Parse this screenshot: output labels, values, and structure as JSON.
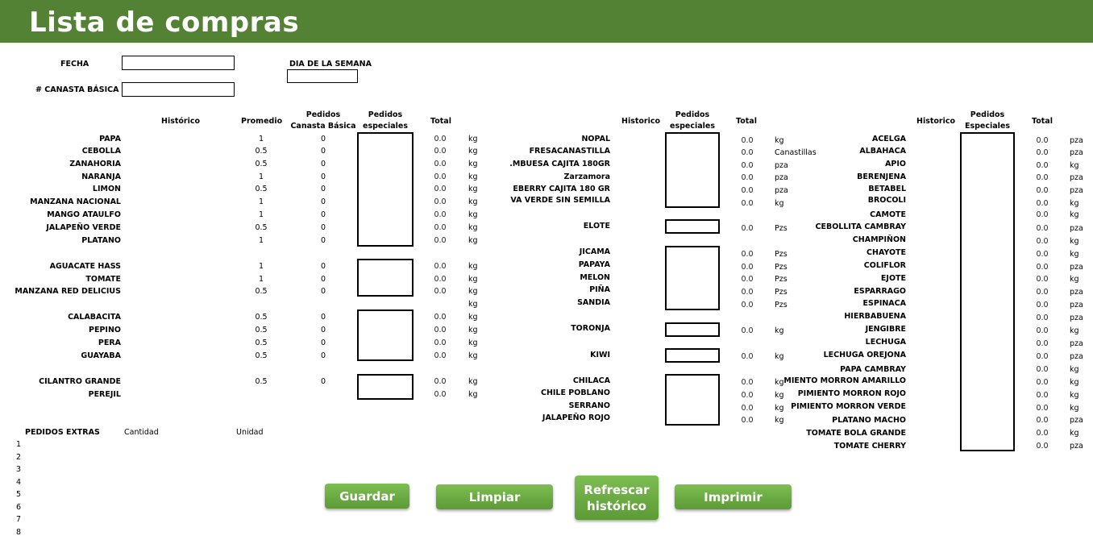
{
  "header": {
    "title": "Lista de compras"
  },
  "form": {
    "fecha_label": "FECHA",
    "dia_label": "DIA DE LA SEMANA",
    "canasta_label": "# CANASTA BÁSICA"
  },
  "col1": {
    "headers": {
      "historico": "Histórico",
      "promedio": "Promedio",
      "pedidos_canasta": "Pedidos Canasta Básica",
      "pedidos_especiales": "Pedidos especiales",
      "total": "Total"
    },
    "rows": [
      {
        "name": "PAPA",
        "promedio": "1",
        "canasta": "0",
        "total": "0.0",
        "unit": "kg"
      },
      {
        "name": "CEBOLLA",
        "promedio": "0.5",
        "canasta": "0",
        "total": "0.0",
        "unit": "kg"
      },
      {
        "name": "ZANAHORIA",
        "promedio": "0.5",
        "canasta": "0",
        "total": "0.0",
        "unit": "kg"
      },
      {
        "name": "NARANJA",
        "promedio": "1",
        "canasta": "0",
        "total": "0.0",
        "unit": "kg"
      },
      {
        "name": "LIMON",
        "promedio": "0.5",
        "canasta": "0",
        "total": "0.0",
        "unit": "kg"
      },
      {
        "name": "MANZANA NACIONAL",
        "promedio": "1",
        "canasta": "0",
        "total": "0.0",
        "unit": "kg"
      },
      {
        "name": "MANGO ATAULFO",
        "promedio": "1",
        "canasta": "0",
        "total": "0.0",
        "unit": "kg"
      },
      {
        "name": "JALAPEÑO VERDE",
        "promedio": "0.5",
        "canasta": "0",
        "total": "0.0",
        "unit": "kg"
      },
      {
        "name": "PLATANO",
        "promedio": "1",
        "canasta": "0",
        "total": "0.0",
        "unit": "kg"
      },
      {
        "name": "AGUACATE HASS",
        "promedio": "1",
        "canasta": "0",
        "total": "0.0",
        "unit": "kg"
      },
      {
        "name": "TOMATE",
        "promedio": "1",
        "canasta": "0",
        "total": "0.0",
        "unit": "kg"
      },
      {
        "name": "MANZANA RED DELICIUS",
        "promedio": "0.5",
        "canasta": "0",
        "total": "0.0",
        "unit": "kg"
      },
      {
        "name": "",
        "promedio": "",
        "canasta": "",
        "total": "",
        "unit": "kg"
      },
      {
        "name": "CALABACITA",
        "promedio": "0.5",
        "canasta": "0",
        "total": "0.0",
        "unit": "kg"
      },
      {
        "name": "PEPINO",
        "promedio": "0.5",
        "canasta": "0",
        "total": "0.0",
        "unit": "kg"
      },
      {
        "name": "PERA",
        "promedio": "0.5",
        "canasta": "0",
        "total": "0.0",
        "unit": "kg"
      },
      {
        "name": "GUAYABA",
        "promedio": "0.5",
        "canasta": "0",
        "total": "0.0",
        "unit": "kg"
      },
      {
        "name": "CILANTRO GRANDE",
        "promedio": "0.5",
        "canasta": "0",
        "total": "0.0",
        "unit": "kg"
      },
      {
        "name": "PEREJIL",
        "promedio": "",
        "canasta": "",
        "total": "0.0",
        "unit": "kg"
      }
    ]
  },
  "col2": {
    "headers": {
      "historico": "Historico",
      "pedidos_especiales": "Pedidos especiales",
      "total": "Total"
    },
    "rows": [
      {
        "name": "NOPAL",
        "total": "0.0",
        "unit": "kg"
      },
      {
        "name": "FRESACANASTILLA",
        "total": "0.0",
        "unit": "Canastillas"
      },
      {
        "name": ".MBUESA CAJITA 180GR",
        "total": "0.0",
        "unit": "pza"
      },
      {
        "name": "Zarzamora",
        "total": "0.0",
        "unit": "pza"
      },
      {
        "name": "EBERRY CAJITA 180 GR",
        "total": "0.0",
        "unit": "pza"
      },
      {
        "name": "VA VERDE SIN SEMILLA",
        "total": "0.0",
        "unit": "kg"
      },
      {
        "name": "ELOTE",
        "total": "0.0",
        "unit": "Pzs"
      },
      {
        "name": "JICAMA",
        "total": "0.0",
        "unit": "Pzs"
      },
      {
        "name": "PAPAYA",
        "total": "0.0",
        "unit": "Pzs"
      },
      {
        "name": "MELON",
        "total": "0.0",
        "unit": "Pzs"
      },
      {
        "name": "PIÑA",
        "total": "0.0",
        "unit": "Pzs"
      },
      {
        "name": "SANDIA",
        "total": "0.0",
        "unit": "Pzs"
      },
      {
        "name": "TORONJA",
        "total": "0.0",
        "unit": "kg"
      },
      {
        "name": "KIWI",
        "total": "0.0",
        "unit": "kg"
      },
      {
        "name": "CHILACA",
        "total": "0.0",
        "unit": "kg"
      },
      {
        "name": "CHILE POBLANO",
        "total": "0.0",
        "unit": "kg"
      },
      {
        "name": "SERRANO",
        "total": "0.0",
        "unit": "kg"
      },
      {
        "name": "JALAPEÑO ROJO",
        "total": "0.0",
        "unit": "kg"
      }
    ]
  },
  "col3": {
    "headers": {
      "historico": "Historico",
      "pedidos_especiales": "Pedidos Especiales",
      "total": "Total"
    },
    "rows": [
      {
        "name": "ACELGA",
        "total": "0.0",
        "unit": "pza"
      },
      {
        "name": "ALBAHACA",
        "total": "0.0",
        "unit": "pza"
      },
      {
        "name": "APIO",
        "total": "0.0",
        "unit": "kg"
      },
      {
        "name": "BERENJENA",
        "total": "0.0",
        "unit": "pza"
      },
      {
        "name": "BETABEL",
        "total": "0.0",
        "unit": "pza"
      },
      {
        "name": "BROCOLI",
        "total": "0.0",
        "unit": "kg"
      },
      {
        "name": "CAMOTE",
        "total": "0.0",
        "unit": "kg"
      },
      {
        "name": "CEBOLLITA CAMBRAY",
        "total": "0.0",
        "unit": "pza"
      },
      {
        "name": "CHAMPIÑON",
        "total": "0.0",
        "unit": "kg"
      },
      {
        "name": "CHAYOTE",
        "total": "0.0",
        "unit": "kg"
      },
      {
        "name": "COLIFLOR",
        "total": "0.0",
        "unit": "pza"
      },
      {
        "name": "EJOTE",
        "total": "0.0",
        "unit": "kg"
      },
      {
        "name": "ESPARRAGO",
        "total": "0.0",
        "unit": "pza"
      },
      {
        "name": "ESPINACA",
        "total": "0.0",
        "unit": "pza"
      },
      {
        "name": "HIERBABUENA",
        "total": "0.0",
        "unit": "pza"
      },
      {
        "name": "JENGIBRE",
        "total": "0.0",
        "unit": "kg"
      },
      {
        "name": "LECHUGA",
        "total": "0.0",
        "unit": "pza"
      },
      {
        "name": "LECHUGA OREJONA",
        "total": "0.0",
        "unit": "pza"
      },
      {
        "name": "PAPA CAMBRAY",
        "total": "0.0",
        "unit": "kg"
      },
      {
        "name": "MIENTO MORRON AMARILLO",
        "total": "0.0",
        "unit": "kg"
      },
      {
        "name": "PIMIENTO MORRON ROJO",
        "total": "0.0",
        "unit": "kg"
      },
      {
        "name": "PIMIENTO MORRON VERDE",
        "total": "0.0",
        "unit": "kg"
      },
      {
        "name": "PLATANO MACHO",
        "total": "0.0",
        "unit": "pza"
      },
      {
        "name": "TOMATE BOLA GRANDE",
        "total": "0.0",
        "unit": "kg"
      },
      {
        "name": "TOMATE CHERRY",
        "total": "0.0",
        "unit": "pza"
      }
    ]
  },
  "extras": {
    "title": "PEDIDOS EXTRAS",
    "cantidad": "Cantidad",
    "unidad": "Unidad",
    "rows": [
      "1",
      "2",
      "3",
      "4",
      "5",
      "6",
      "7",
      "8"
    ]
  },
  "buttons": {
    "guardar": "Guardar",
    "limpiar": "Limpiar",
    "refrescar": "Refrescar histórico",
    "imprimir": "Imprimir"
  }
}
